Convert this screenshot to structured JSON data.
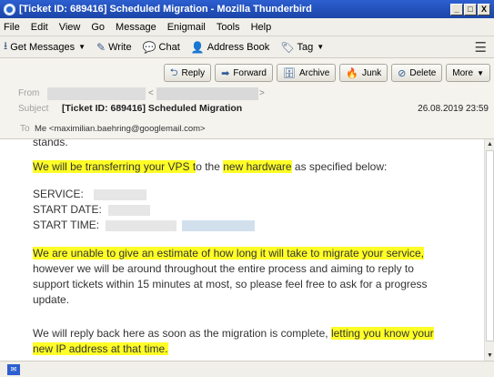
{
  "window": {
    "title": "[Ticket ID: 689416] Scheduled Migration - Mozilla Thunderbird",
    "minimize": "_",
    "maximize": "□",
    "close": "X"
  },
  "menu": [
    "File",
    "Edit",
    "View",
    "Go",
    "Message",
    "Enigmail",
    "Tools",
    "Help"
  ],
  "toolbar": {
    "get_messages": "Get Messages",
    "write": "Write",
    "chat": "Chat",
    "address_book": "Address Book",
    "tag": "Tag"
  },
  "actions": {
    "reply": "Reply",
    "forward": "Forward",
    "archive": "Archive",
    "junk": "Junk",
    "delete": "Delete",
    "more": "More"
  },
  "header": {
    "from_label": "From",
    "subject_label": "Subject",
    "subject": "[Ticket ID: 689416] Scheduled Migration",
    "date": "26.08.2019 23:59",
    "to_label": "To",
    "to": "Me <maximilian.baehring@googlemail.com>"
  },
  "body": {
    "partial_line": "stands.",
    "p1_hl1": "We will be transferring your VPS t",
    "p1_mid": "o the ",
    "p1_hl2": "new hardware",
    "p1_end": " as specified below:",
    "service_label": "SERVICE:",
    "start_date_label": "START DATE:",
    "start_time_label": "START TIME:",
    "p2_hl": "We are unable to give an estimate of how long it will take to migrate your service,",
    "p2_rest1": "however we will be around throughout the entire process and aiming to reply to",
    "p2_rest2": "support tickets within 15 minutes at most, so please feel free to ask for a progress",
    "p2_rest3": "update.",
    "p3_start": "We will reply back here as soon as the migration is complete, ",
    "p3_hl1": "letting you know your",
    "p3_hl2": "new IP address at that time."
  },
  "colors": {
    "highlight": "#fffe26",
    "titlebar": "#2c5fd0"
  }
}
